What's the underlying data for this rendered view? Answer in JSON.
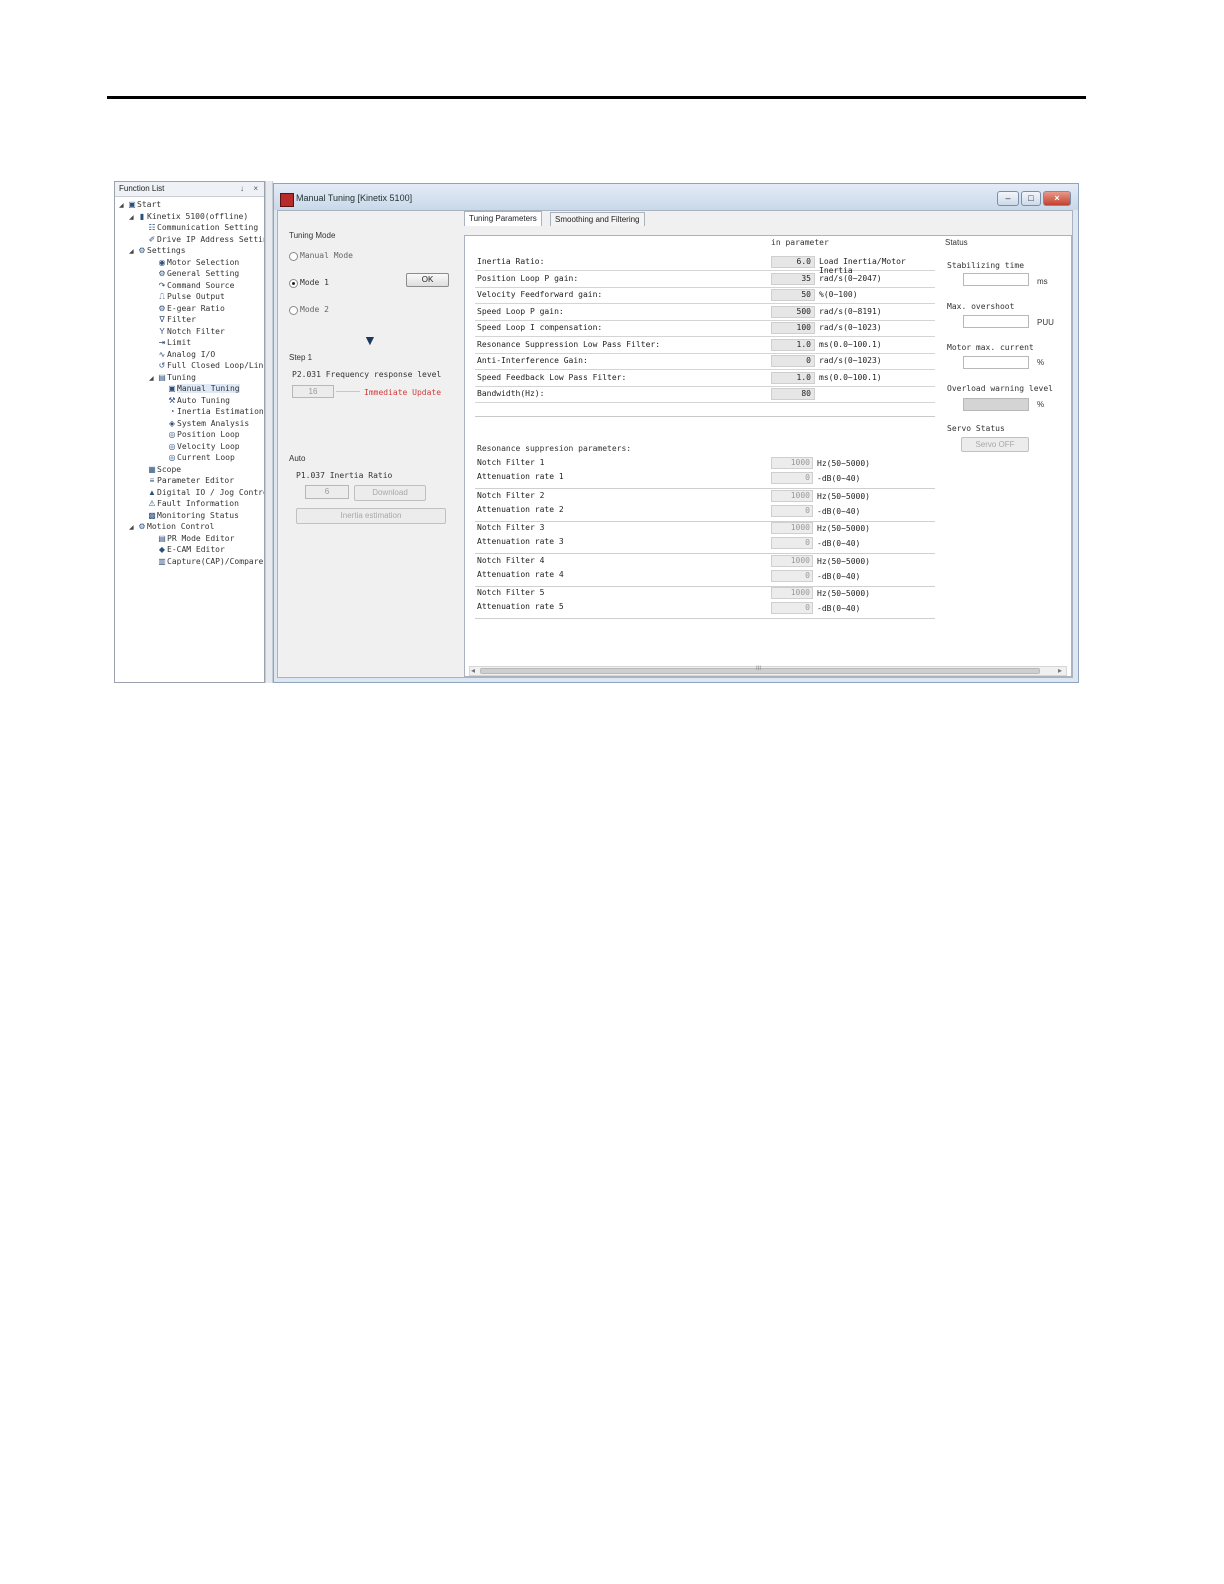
{
  "function_list": {
    "header": "Function List",
    "pin": "↓",
    "close": "×",
    "items": [
      {
        "label": "Start",
        "icon": "home-icon",
        "twisty": "◢"
      },
      {
        "label": "Kinetix 5100(offline)",
        "icon": "drive-icon",
        "twisty": "◢"
      },
      {
        "label": "Communication Setting",
        "icon": "network-icon"
      },
      {
        "label": "Drive IP Address Setting",
        "icon": "ip-icon"
      },
      {
        "label": "Settings",
        "icon": "settings-icon",
        "twisty": "◢"
      },
      {
        "label": "Motor Selection",
        "icon": "motor-icon"
      },
      {
        "label": "General Setting",
        "icon": "gear-icon"
      },
      {
        "label": "Command Source",
        "icon": "command-icon"
      },
      {
        "label": "Pulse Output",
        "icon": "pulse-icon"
      },
      {
        "label": "E-gear Ratio",
        "icon": "egear-icon"
      },
      {
        "label": "Filter",
        "icon": "filter-icon"
      },
      {
        "label": "Notch Filter",
        "icon": "notch-icon"
      },
      {
        "label": "Limit",
        "icon": "limit-icon"
      },
      {
        "label": "Analog I/O",
        "icon": "analog-icon"
      },
      {
        "label": "Full Closed Loop/Linear",
        "icon": "loop-icon"
      },
      {
        "label": "Tuning",
        "icon": "tuning-icon",
        "twisty": "◢"
      },
      {
        "label": "Manual Tuning",
        "icon": "manual-tuning-icon"
      },
      {
        "label": "Auto Tuning",
        "icon": "auto-tuning-icon"
      },
      {
        "label": "Inertia Estimation",
        "icon": "inertia-icon"
      },
      {
        "label": "System Analysis",
        "icon": "analysis-icon"
      },
      {
        "label": "Position Loop",
        "icon": "position-icon"
      },
      {
        "label": "Velocity Loop",
        "icon": "velocity-icon"
      },
      {
        "label": "Current Loop",
        "icon": "current-icon"
      },
      {
        "label": "Scope",
        "icon": "scope-icon"
      },
      {
        "label": "Parameter Editor",
        "icon": "parameter-icon"
      },
      {
        "label": "Digital IO / Jog Control",
        "icon": "io-icon"
      },
      {
        "label": "Fault Information",
        "icon": "warning-icon"
      },
      {
        "label": "Monitoring Status",
        "icon": "monitor-icon"
      },
      {
        "label": "Motion Control",
        "icon": "motion-icon",
        "twisty": "◢"
      },
      {
        "label": "PR Mode Editor",
        "icon": "pr-icon"
      },
      {
        "label": "E-CAM Editor",
        "icon": "ecam-icon"
      },
      {
        "label": "Capture(CAP)/Compare",
        "icon": "capture-icon"
      }
    ]
  },
  "window": {
    "title": "Manual Tuning [Kinetix 5100]",
    "min": "–",
    "max": "□",
    "close": "×"
  },
  "left": {
    "tuning_mode": "Tuning Mode",
    "manual_mode": "Manual Mode",
    "mode1": "Mode 1",
    "mode2": "Mode 2",
    "ok": "OK",
    "arrow": "▼",
    "step1": "Step 1",
    "freq_label": "P2.031 Frequency response level",
    "freq_value": "16",
    "immediate": "Immediate Update",
    "auto": "Auto",
    "inertia_ratio_label": "P1.037 Inertia Ratio",
    "inertia_value": "6",
    "download": "Download",
    "inertia_estimation": "Inertia estimation"
  },
  "tabs": {
    "tuning_parameters": "Tuning Parameters",
    "smoothing": "Smoothing and Filtering"
  },
  "params": {
    "header": "in parameter",
    "rows": [
      {
        "label": "Inertia Ratio:",
        "value": "6.0",
        "unit": "Load Inertia/Motor Inertia"
      },
      {
        "label": "Position Loop P gain:",
        "value": "35",
        "unit": "rad/s(0~2047)"
      },
      {
        "label": "Velocity Feedforward gain:",
        "value": "50",
        "unit": "%(0~100)"
      },
      {
        "label": "Speed Loop P gain:",
        "value": "500",
        "unit": "rad/s(0~8191)"
      },
      {
        "label": "Speed Loop I compensation:",
        "value": "100",
        "unit": "rad/s(0~1023)"
      },
      {
        "label": "Resonance Suppression Low Pass Filter:",
        "value": "1.0",
        "unit": "ms(0.0~100.1)"
      },
      {
        "label": "Anti-Interference Gain:",
        "value": "0",
        "unit": "rad/s(0~1023)"
      },
      {
        "label": "Speed Feedback Low Pass Filter:",
        "value": "1.0",
        "unit": "ms(0.0~100.1)"
      },
      {
        "label": "Bandwidth(Hz):",
        "value": "80",
        "unit": ""
      }
    ],
    "resonance_header": "Resonance suppresion parameters:",
    "notches": [
      {
        "label": "Notch Filter 1",
        "att": "Attenuation rate 1",
        "hz": "1000",
        "db": "0",
        "hz_unit": "Hz(50~5000)",
        "db_unit": "-dB(0~40)"
      },
      {
        "label": "Notch Filter 2",
        "att": "Attenuation rate 2",
        "hz": "1000",
        "db": "0",
        "hz_unit": "Hz(50~5000)",
        "db_unit": "-dB(0~40)"
      },
      {
        "label": "Notch Filter 3",
        "att": "Attenuation rate 3",
        "hz": "1000",
        "db": "0",
        "hz_unit": "Hz(50~5000)",
        "db_unit": "-dB(0~40)"
      },
      {
        "label": "Notch Filter 4",
        "att": "Attenuation rate 4",
        "hz": "1000",
        "db": "0",
        "hz_unit": "Hz(50~5000)",
        "db_unit": "-dB(0~40)"
      },
      {
        "label": "Notch Filter 5",
        "att": "Attenuation rate 5",
        "hz": "1000",
        "db": "0",
        "hz_unit": "Hz(50~5000)",
        "db_unit": "-dB(0~40)"
      }
    ]
  },
  "status": {
    "title": "Status",
    "stabilizing": "Stabilizing time",
    "ms": "ms",
    "overshoot": "Max. overshoot",
    "puu": "PUU",
    "motor_current": "Motor max. current",
    "pct1": "%",
    "overload": "Overload warning level",
    "pct2": "%",
    "servo_status": "Servo Status",
    "servo_off": "Servo OFF"
  },
  "scroll": {
    "left": "◂",
    "right": "▸",
    "grip": "III"
  },
  "colors": {
    "accent_red": "#d23c3c",
    "window_frame": "#8fa4bd"
  }
}
